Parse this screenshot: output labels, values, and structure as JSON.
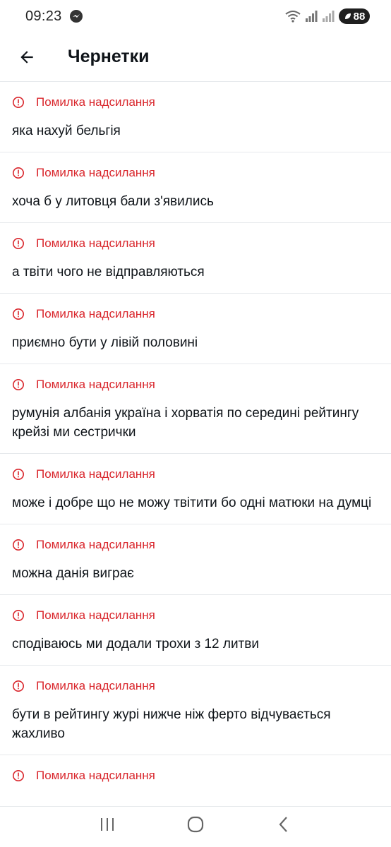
{
  "status_bar": {
    "time": "09:23",
    "battery": "88"
  },
  "header": {
    "title": "Чернетки"
  },
  "error_label": "Помилка надсилання",
  "drafts": [
    {
      "error": "Помилка надсилання",
      "text": "яка нахуй бельгія"
    },
    {
      "error": "Помилка надсилання",
      "text": "хоча б у литовця бали з'явились"
    },
    {
      "error": "Помилка надсилання",
      "text": "а твіти чого не відправляються"
    },
    {
      "error": "Помилка надсилання",
      "text": "приємно бути у лівій половині"
    },
    {
      "error": "Помилка надсилання",
      "text": "румунія албанія україна і хорватія по середині рейтингу крейзі ми сестрички"
    },
    {
      "error": "Помилка надсилання",
      "text": "може і добре що не можу твітити бо одні матюки на думці"
    },
    {
      "error": "Помилка надсилання",
      "text": "можна данія виграє"
    },
    {
      "error": "Помилка надсилання",
      "text": "сподіваюсь ми додали трохи з 12 литви"
    },
    {
      "error": "Помилка надсилання",
      "text": "бути в рейтингу журі нижче ніж ферто відчувається жахливо"
    },
    {
      "error": "Помилка надсилання",
      "text": ""
    }
  ],
  "colors": {
    "error": "#d9262c",
    "divider": "#e6e9ec",
    "text": "#0f1419"
  },
  "icons": {
    "back": "arrow-left-icon",
    "error": "alert-circle-icon",
    "nav_recents": "recents-icon",
    "nav_home": "home-icon",
    "nav_back": "back-chevron-icon"
  }
}
